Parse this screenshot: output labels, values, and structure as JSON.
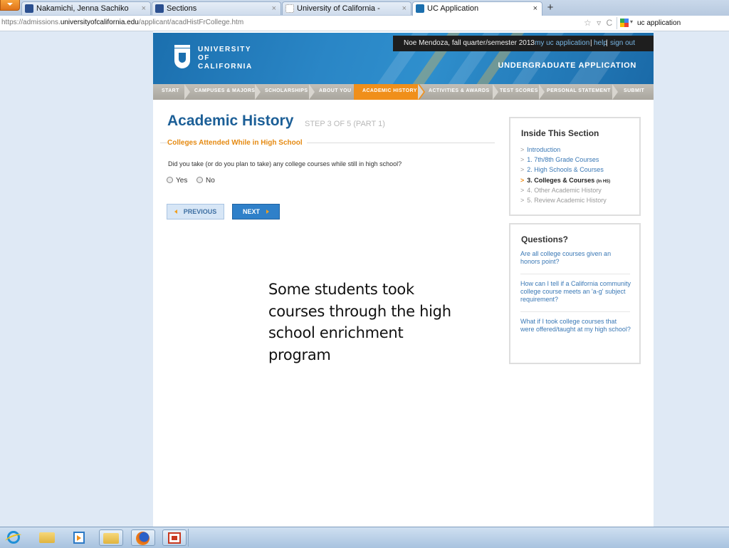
{
  "browser": {
    "tabs": [
      {
        "title": "Nakamichi, Jenna Sachiko",
        "icon": "letter-p-icon",
        "active": false
      },
      {
        "title": "Sections",
        "icon": "letter-p-icon",
        "active": false
      },
      {
        "title": "University of California -",
        "icon": "page-icon",
        "active": false
      },
      {
        "title": "UC Application",
        "icon": "uc-icon",
        "active": true
      }
    ],
    "close_glyph": "×",
    "new_tab_glyph": "+",
    "url_prefix": "https://admissions.",
    "url_host": "universityofcalifornia.edu",
    "url_path": "/applicant/acadHistFrCollege.htm",
    "url_icons": "☆ ▿ C",
    "search_text": "uc application"
  },
  "header": {
    "logo_lines": [
      "UNIVERSITY",
      "OF",
      "CALIFORNIA"
    ],
    "user_text": "Noe Mendoza, fall quarter/semester 2013",
    "separator": ":",
    "link_my_app": "my uc application",
    "pipe": "|",
    "link_help": "help",
    "link_sign_out": "sign out",
    "app_title": "UNDERGRADUATE APPLICATION",
    "colors": {
      "banner": "#1b6fae",
      "accent": "#f08f1a"
    }
  },
  "steps": [
    {
      "label": "START",
      "active": false
    },
    {
      "label": "CAMPUSES & MAJORS",
      "active": false
    },
    {
      "label": "SCHOLARSHIPS",
      "active": false
    },
    {
      "label": "ABOUT YOU",
      "active": false
    },
    {
      "label": "ACADEMIC HISTORY",
      "active": true
    },
    {
      "label": "ACTIVITIES & AWARDS",
      "active": false
    },
    {
      "label": "TEST SCORES",
      "active": false
    },
    {
      "label": "PERSONAL STATEMENT",
      "active": false
    },
    {
      "label": "SUBMIT",
      "active": false
    }
  ],
  "main": {
    "title": "Academic History",
    "step_of": "STEP 3 OF 5 (PART 1)",
    "subtitle": "Colleges Attended While in High School",
    "question": "Did you take (or do you plan to take) any college courses while still in high school?",
    "options": [
      "Yes",
      "No"
    ],
    "prev_label": "PREVIOUS",
    "next_label": "NEXT"
  },
  "inside_section": {
    "heading": "Inside This Section",
    "chevron": ">",
    "items": [
      {
        "label": "Introduction",
        "state": "link"
      },
      {
        "label": "1. 7th/8th Grade Courses",
        "state": "link"
      },
      {
        "label": "2. High Schools & Courses",
        "state": "link"
      },
      {
        "label": "3. Colleges & Courses",
        "suffix": "(In HS)",
        "state": "current"
      },
      {
        "label": "4. Other Academic History",
        "state": "dim"
      },
      {
        "label": "5. Review Academic History",
        "state": "dim"
      }
    ]
  },
  "questions_box": {
    "heading": "Questions?",
    "links": [
      "Are all college courses given an honors point?",
      "How can I tell if a California community college course meets an 'a-g' subject requirement?",
      "What if I took college courses that were offered/taught at my high school?"
    ]
  },
  "note": "Some students took courses through the high school enrichment program",
  "taskbar": {
    "items": [
      "internet-explorer-icon",
      "file-explorer-icon",
      "media-player-icon",
      "folder-icon",
      "firefox-icon",
      "powerpoint-icon"
    ]
  }
}
